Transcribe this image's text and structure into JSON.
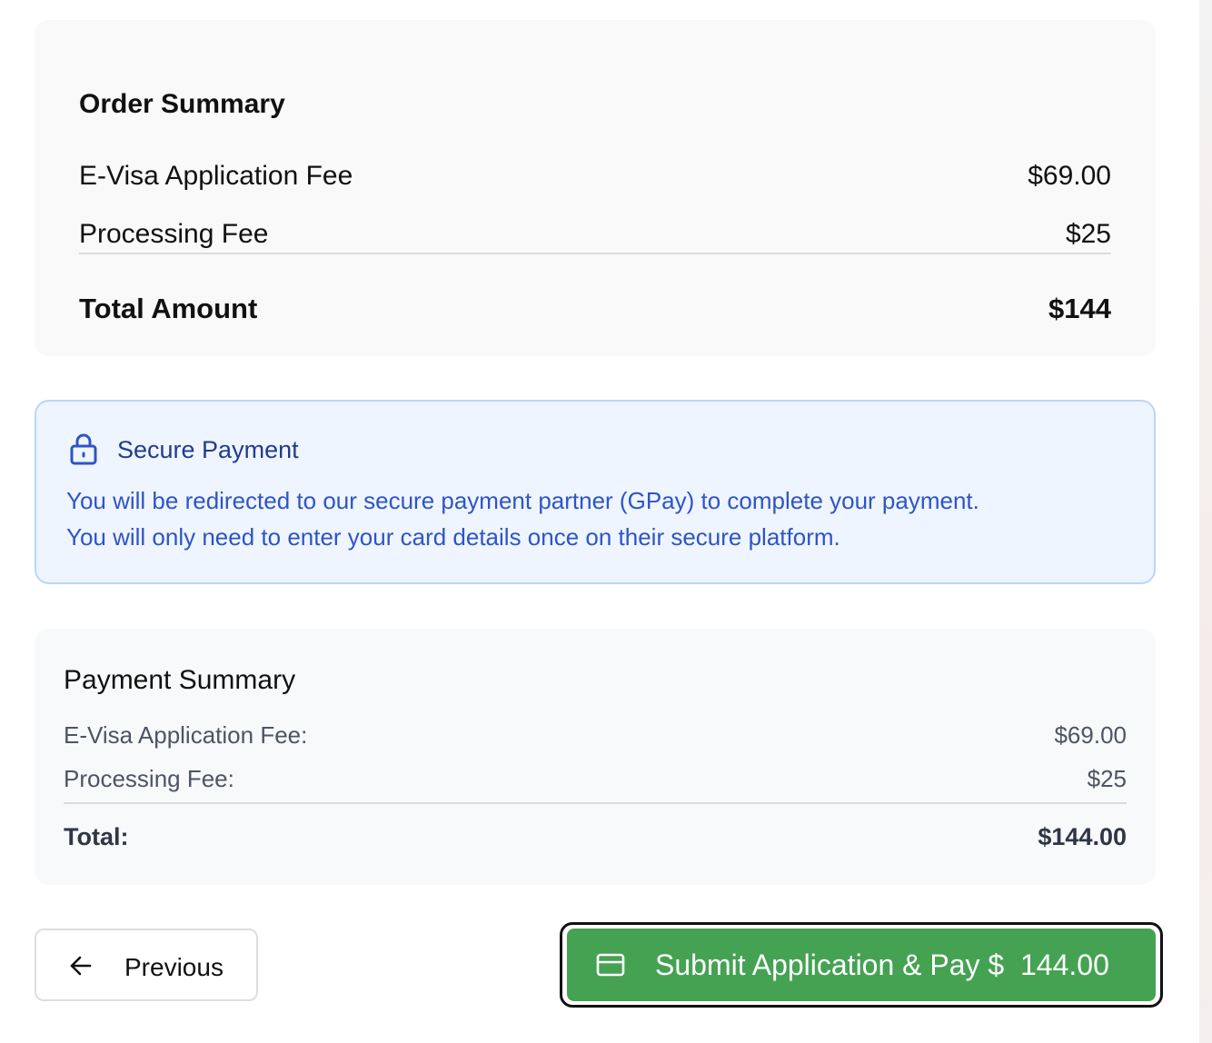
{
  "order_summary": {
    "title": "Order Summary",
    "rows": [
      {
        "label": "E-Visa Application Fee",
        "value": "$69.00"
      },
      {
        "label": "Processing Fee",
        "value": "$25"
      }
    ],
    "total_label": "Total Amount",
    "total_value": "$144"
  },
  "secure_payment": {
    "icon": "lock-icon",
    "title": "Secure Payment",
    "line1": "You will be redirected to our secure payment partner (GPay) to complete your payment.",
    "line2": "You will only need to enter your card details once on their secure platform."
  },
  "payment_summary": {
    "title": "Payment Summary",
    "rows": [
      {
        "label": "E-Visa Application Fee:",
        "value": "$69.00"
      },
      {
        "label": "Processing Fee:",
        "value": "$25"
      }
    ],
    "total_label": "Total:",
    "total_value": "$144.00"
  },
  "actions": {
    "previous_label": "Previous",
    "previous_icon": "arrow-left-icon",
    "submit_label": "Submit Application & Pay $  144.00",
    "submit_icon": "credit-card-icon"
  },
  "colors": {
    "accent_green": "#45a253",
    "info_blue": "#2f54c6",
    "info_background": "#eef5fe"
  }
}
